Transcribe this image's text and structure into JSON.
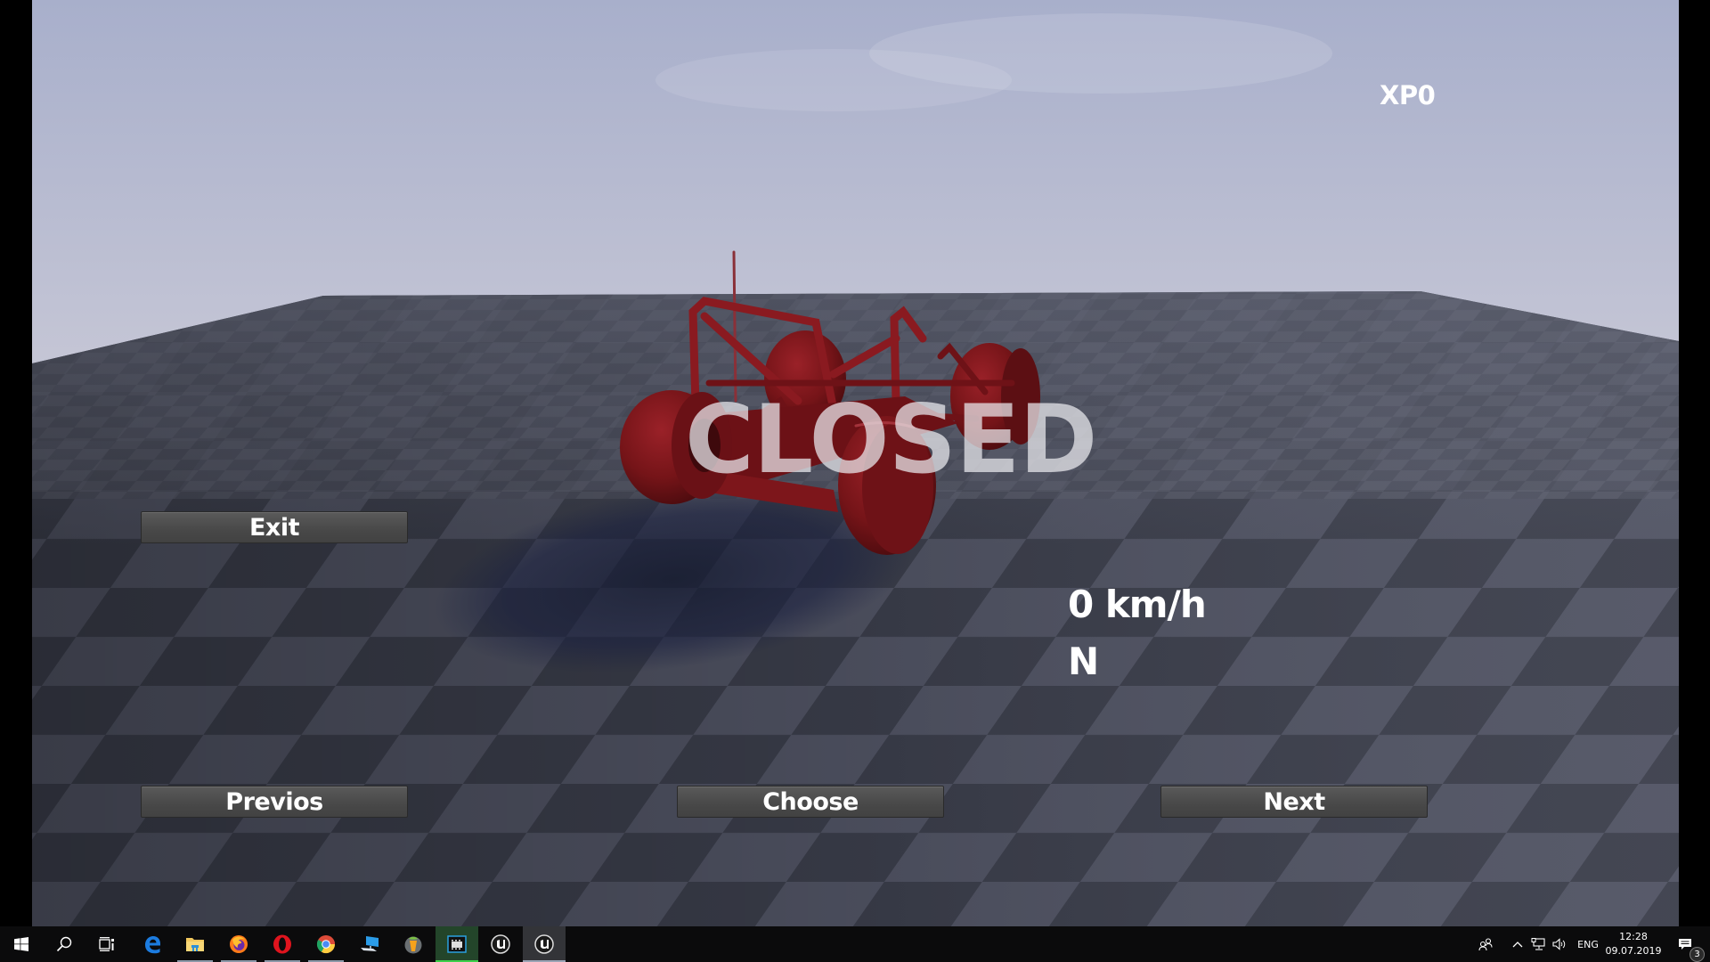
{
  "game": {
    "hud": {
      "xp": "XP0",
      "status_overlay": "CLOSED",
      "speed": "0 km/h",
      "gear": "N"
    },
    "buttons": {
      "exit": "Exit",
      "previous": "Previos",
      "choose": "Choose",
      "next": "Next"
    },
    "colors": {
      "vehicle": "#7a1418",
      "sky_top": "#a9b0cc",
      "sky_bottom": "#d4d6e3",
      "floor_dark": "#3a3c4a",
      "floor_light": "#5d6070",
      "button_bg": "#4c4c4c"
    }
  },
  "taskbar": {
    "pinned": [
      {
        "name": "start",
        "icon": "windows-logo-icon"
      },
      {
        "name": "search",
        "icon": "search-icon"
      },
      {
        "name": "task-view",
        "icon": "task-view-icon"
      },
      {
        "name": "edge",
        "icon": "edge-icon"
      },
      {
        "name": "file-explorer",
        "icon": "folder-icon",
        "running": true
      },
      {
        "name": "firefox",
        "icon": "firefox-icon",
        "running": true
      },
      {
        "name": "opera",
        "icon": "opera-icon",
        "running": true
      },
      {
        "name": "chrome",
        "icon": "chrome-icon",
        "running": true
      },
      {
        "name": "this-pc",
        "icon": "computer-icon"
      },
      {
        "name": "fl-studio",
        "icon": "fruity-icon"
      },
      {
        "name": "video-editor",
        "icon": "film-icon",
        "active": true
      },
      {
        "name": "unreal-engine-1",
        "icon": "unreal-icon"
      },
      {
        "name": "unreal-engine-2",
        "icon": "unreal-icon",
        "active": true
      }
    ],
    "tray": {
      "language": "ENG",
      "time": "12:28",
      "date": "09.07.2019",
      "notifications_count": "3"
    }
  }
}
